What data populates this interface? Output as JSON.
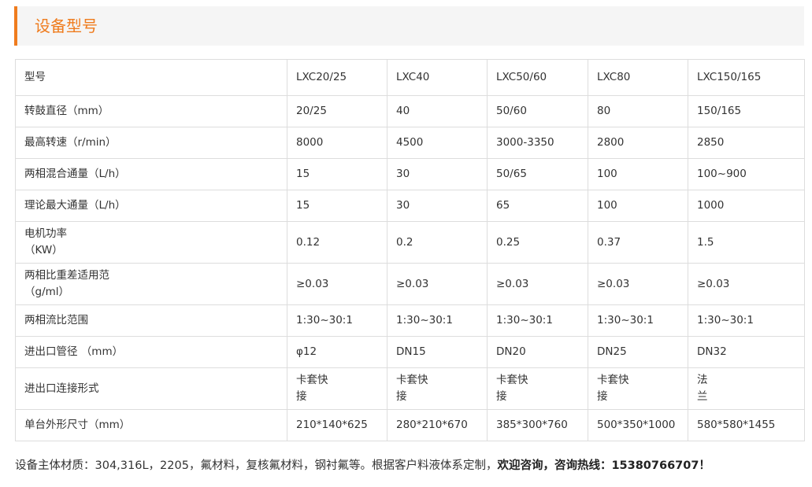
{
  "section": {
    "title": "设备型号",
    "accent_color": "#ef7c1e"
  },
  "table": {
    "rows": [
      {
        "label": [
          "型号"
        ],
        "cells": [
          [
            "LXC20/25"
          ],
          [
            "LXC40"
          ],
          [
            "LXC50/60"
          ],
          [
            "LXC80"
          ],
          [
            "LXC150/165"
          ]
        ]
      },
      {
        "label": [
          "转鼓直径（mm）"
        ],
        "cells": [
          [
            "20/25"
          ],
          [
            "40"
          ],
          [
            "50/60"
          ],
          [
            "80"
          ],
          [
            "150/165"
          ]
        ]
      },
      {
        "label": [
          "最高转速（r/min）"
        ],
        "cells": [
          [
            "8000"
          ],
          [
            "4500"
          ],
          [
            "3000-3350"
          ],
          [
            "2800"
          ],
          [
            "2850"
          ]
        ]
      },
      {
        "label": [
          " 两相混合通量（L/h）"
        ],
        "cells": [
          [
            "15"
          ],
          [
            "30"
          ],
          [
            "50/65"
          ],
          [
            "100"
          ],
          [
            "100~900"
          ]
        ]
      },
      {
        "label": [
          "理论最大通量（L/h）"
        ],
        "cells": [
          [
            "15"
          ],
          [
            "30"
          ],
          [
            "65"
          ],
          [
            "100"
          ],
          [
            "1000"
          ]
        ]
      },
      {
        "label": [
          "电机功率",
          "（KW）"
        ],
        "cells": [
          [
            "0.12"
          ],
          [
            "0.2"
          ],
          [
            "0.25"
          ],
          [
            "0.37"
          ],
          [
            "1.5"
          ]
        ]
      },
      {
        "label": [
          "两相比重差适用范",
          "（g/ml）"
        ],
        "cells": [
          [
            "≥0.03"
          ],
          [
            "≥0.03"
          ],
          [
            "≥0.03"
          ],
          [
            "≥0.03"
          ],
          [
            "≥0.03"
          ]
        ]
      },
      {
        "label": [
          "两相流比范围"
        ],
        "cells": [
          [
            "1:30~30:1"
          ],
          [
            "1:30~30:1"
          ],
          [
            "1:30~30:1"
          ],
          [
            "1:30~30:1"
          ],
          [
            "1:30~30:1"
          ]
        ]
      },
      {
        "label": [
          "进出口管径 （mm）"
        ],
        "cells": [
          [
            "φ12"
          ],
          [
            "DN15"
          ],
          [
            "DN20"
          ],
          [
            "DN25"
          ],
          [
            "DN32"
          ]
        ]
      },
      {
        "label": [
          "进出口连接形式"
        ],
        "cells": [
          [
            "卡套快",
            "接"
          ],
          [
            "卡套快",
            "接"
          ],
          [
            "卡套快",
            "接"
          ],
          [
            "卡套快",
            "接"
          ],
          [
            "法",
            "兰"
          ]
        ]
      },
      {
        "label": [
          "单台外形尺寸（mm）"
        ],
        "cells": [
          [
            "210*140*625"
          ],
          [
            "280*210*670"
          ],
          [
            "385*300*760"
          ],
          [
            "500*350*1000"
          ],
          [
            "580*580*1455"
          ]
        ]
      }
    ]
  },
  "footer": {
    "normal_text": "设备主体材质：304,316L，2205，氟材料，复核氟材料，钢衬氟等。根据客户料液体系定制，",
    "bold_text": "欢迎咨询，咨询热线：15380766707！"
  }
}
